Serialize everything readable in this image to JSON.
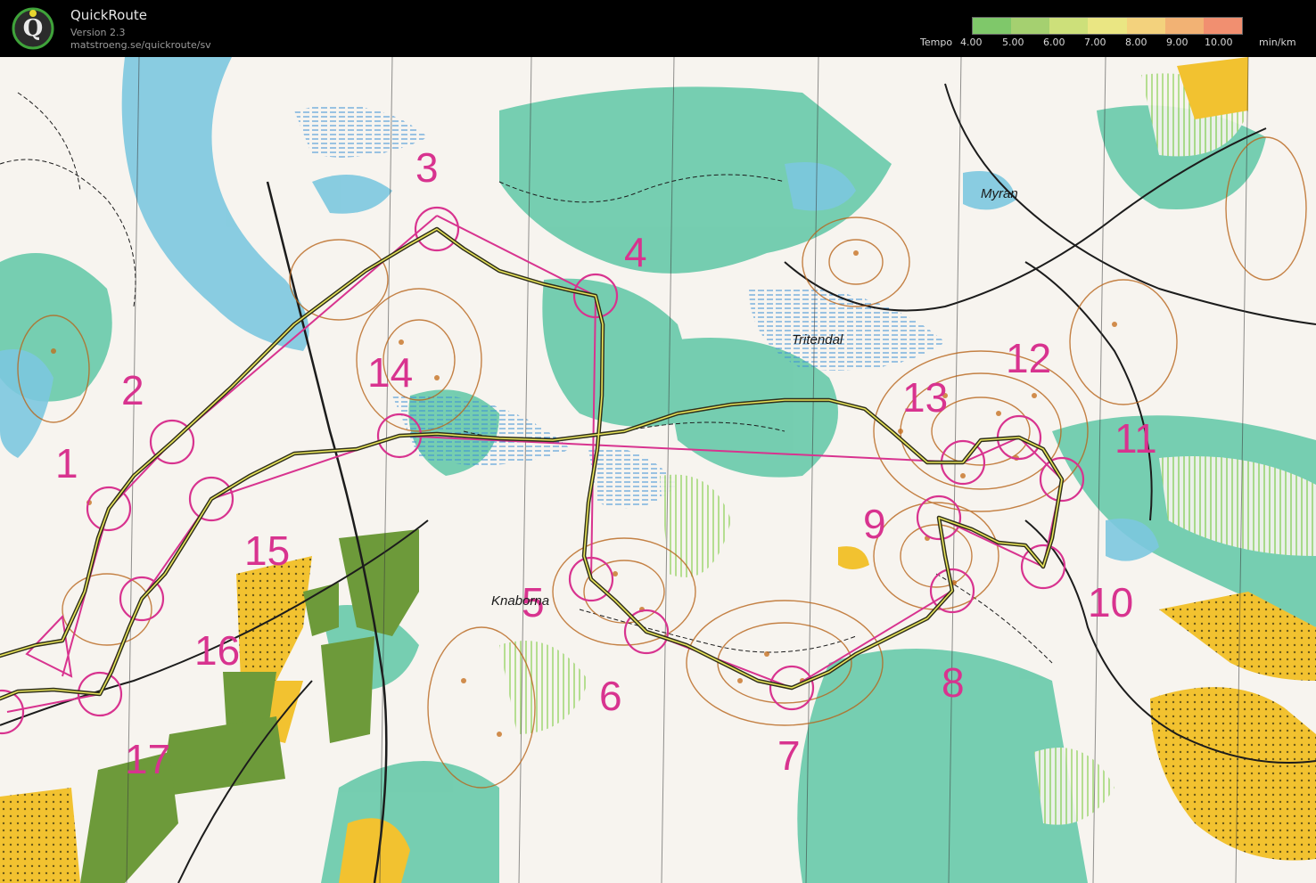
{
  "app": {
    "title": "QuickRoute",
    "version": "Version 2.3",
    "url": "matstroeng.se/quickroute/sv"
  },
  "legend": {
    "label": "Tempo",
    "ticks": [
      "4.00",
      "5.00",
      "6.00",
      "7.00",
      "8.00",
      "9.00",
      "10.00"
    ],
    "unit": "min/km",
    "colors": [
      "#7fc86a",
      "#a5d070",
      "#cde07a",
      "#eae683",
      "#f3d27d",
      "#f2b274",
      "#f18f70"
    ]
  },
  "map": {
    "place_names": [
      "Myran",
      "Tritendal",
      "Knaborna"
    ],
    "controls": [
      {
        "label": "1"
      },
      {
        "label": "2"
      },
      {
        "label": "3"
      },
      {
        "label": "4"
      },
      {
        "label": "5"
      },
      {
        "label": "6"
      },
      {
        "label": "7"
      },
      {
        "label": "8"
      },
      {
        "label": "9"
      },
      {
        "label": "10"
      },
      {
        "label": "11"
      },
      {
        "label": "12"
      },
      {
        "label": "13"
      },
      {
        "label": "14"
      },
      {
        "label": "15"
      },
      {
        "label": "16"
      },
      {
        "label": "17"
      }
    ],
    "colors": {
      "course": "#d8338f",
      "route": "#3d3d20",
      "route_highlight": "#e8e45a",
      "water": "#7cc8df",
      "forest": "#5fc7a6",
      "open_land": "#f2c230",
      "built_up": "#6d9a3a",
      "contour": "#b8651b",
      "paper": "#f7f4ef"
    }
  }
}
